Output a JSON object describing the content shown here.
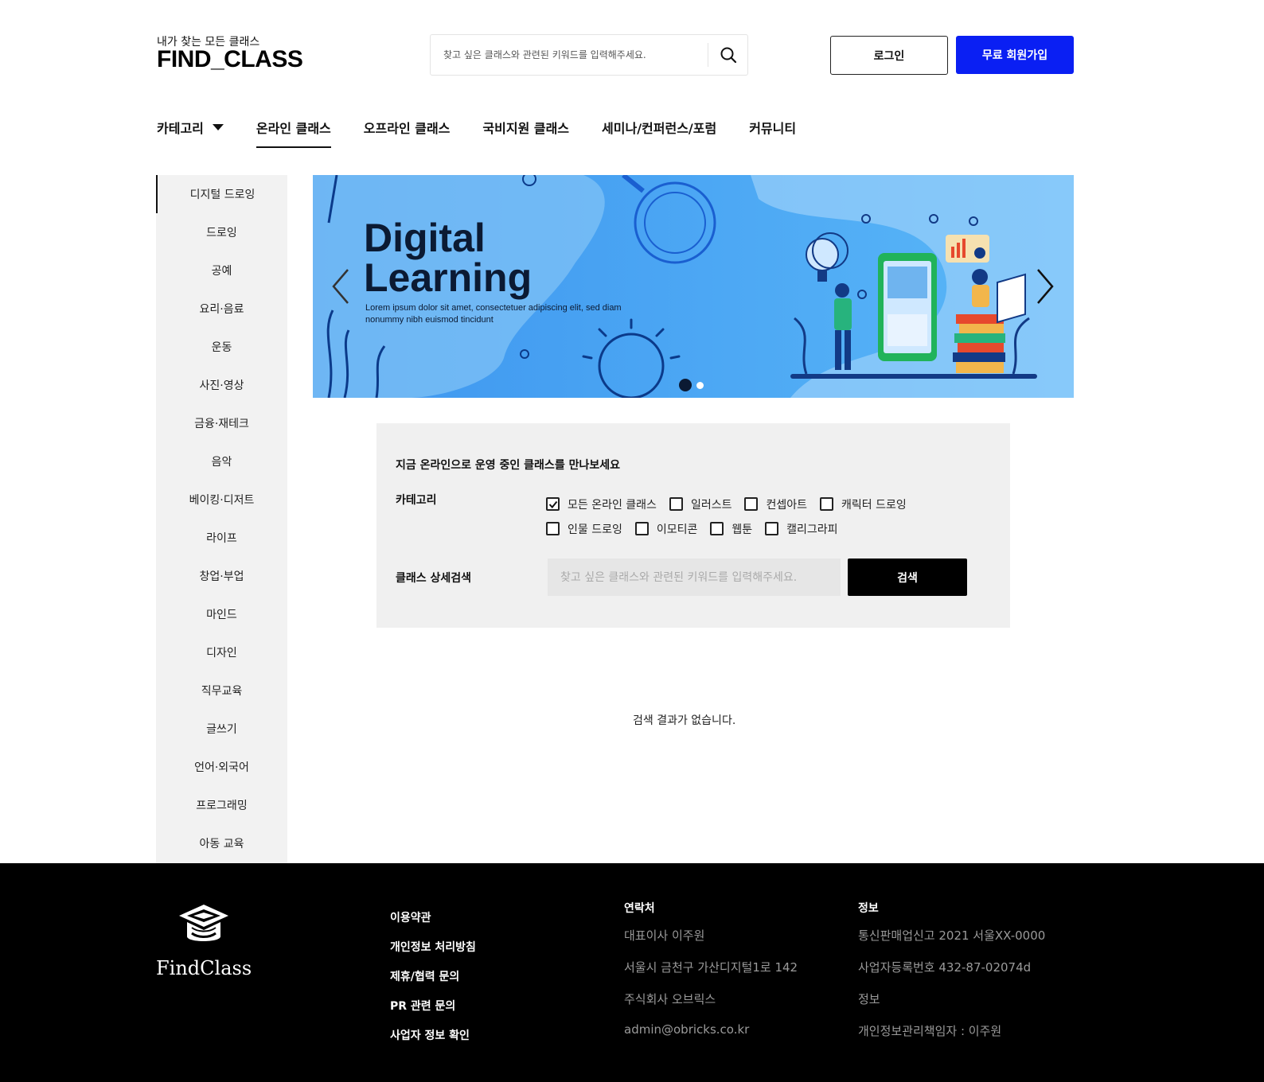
{
  "header": {
    "logo_sub": "내가 찾는 모든 클래스",
    "logo_main": "FIND_CLASS",
    "search_placeholder": "찾고 싶은 클래스와 관련된 키워드를 입력해주세요.",
    "login_label": "로그인",
    "signup_label": "무료 회원가입",
    "signup_color": "#0a1ff3"
  },
  "nav": {
    "items": [
      {
        "label": "카테고리",
        "icon": "caret-down-icon"
      },
      {
        "label": "온라인 클래스"
      },
      {
        "label": "오프라인 클래스"
      },
      {
        "label": "국비지원 클래스"
      },
      {
        "label": "세미나/컨퍼런스/포럼"
      },
      {
        "label": "커뮤니티"
      }
    ],
    "active": "온라인 클래스"
  },
  "sidebar": {
    "items": [
      "디지털 드로잉",
      "드로잉",
      "공예",
      "요리·음료",
      "운동",
      "사진·영상",
      "금융·재테크",
      "음악",
      "베이킹·디저트",
      "라이프",
      "창업·부업",
      "마인드",
      "디자인",
      "직무교육",
      "글쓰기",
      "언어·외국어",
      "프로그래밍",
      "아동 교육"
    ],
    "active": "디지털 드로잉"
  },
  "banner": {
    "title_line1": "Digital",
    "title_line2": "Learning",
    "desc": "Lorem ipsum dolor sit amet, consectetuer adipiscing elit, sed diam nonummy nibh euismod tincidunt",
    "slide_count": 2,
    "active_slide": 1,
    "prev_icon": "chevron-left-icon",
    "next_icon": "chevron-right-icon"
  },
  "filter": {
    "title": "지금 온라인으로 운영 중인 클래스를 만나보세요",
    "category_label": "카테고리",
    "options_row1": [
      {
        "label": "모든 온라인 클래스",
        "checked": true
      },
      {
        "label": "일러스트",
        "checked": false
      },
      {
        "label": "컨셉아트",
        "checked": false
      },
      {
        "label": "캐릭터 드로잉",
        "checked": false
      }
    ],
    "options_row2": [
      {
        "label": "인물 드로잉",
        "checked": false
      },
      {
        "label": "이모티콘",
        "checked": false
      },
      {
        "label": "웹툰",
        "checked": false
      },
      {
        "label": "캘리그라피",
        "checked": false
      }
    ],
    "detail_label": "클래스 상세검색",
    "detail_placeholder": "찾고 싶은 클래스와 관련된 키워드를 입력해주세요.",
    "search_button": "검색"
  },
  "results": {
    "empty_text": "검색 결과가 없습니다."
  },
  "footer": {
    "logo_text": "FindClass",
    "links": [
      "이용약관",
      "개인정보 처리방침",
      "제휴/협력 문의",
      "PR 관련 문의",
      "사업자 정보 확인"
    ],
    "contact_title": "연락처",
    "contact_items": [
      "대표이사 이주원",
      "서울시 금천구 가산디지털1로 142",
      "주식회사 오브릭스",
      "admin@obricks.co.kr"
    ],
    "info_title": "정보",
    "info_items": [
      "통신판매업신고 2021 서울XX-0000",
      "사업자등록번호 432-87-02074d",
      "정보",
      "개인정보관리책임자 : 이주원"
    ]
  }
}
